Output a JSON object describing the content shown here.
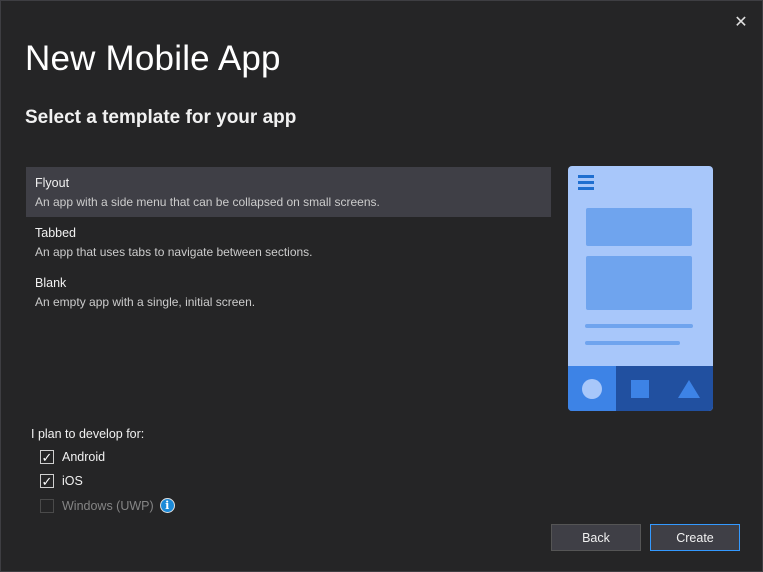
{
  "dialog": {
    "title": "New Mobile App",
    "subtitle": "Select a template for your app",
    "close_glyph": "✕"
  },
  "templates": [
    {
      "name": "Flyout",
      "description": "An app with a side menu that can be collapsed on small screens.",
      "selected": true
    },
    {
      "name": "Tabbed",
      "description": "An app that uses tabs to navigate between sections.",
      "selected": false
    },
    {
      "name": "Blank",
      "description": "An empty app with a single, initial screen.",
      "selected": false
    }
  ],
  "preview": {
    "icons": [
      "hamburger-menu-icon",
      "circle-tab-icon",
      "square-tab-icon",
      "triangle-tab-icon"
    ],
    "colors": {
      "background": "#a8c7fa",
      "accent": "#6fa4ee",
      "tabbar": "#2150a0",
      "active_tab": "#3d83e6"
    }
  },
  "platforms": {
    "label": "I plan to develop for:",
    "options": [
      {
        "label": "Android",
        "checked": true,
        "enabled": true
      },
      {
        "label": "iOS",
        "checked": true,
        "enabled": true
      },
      {
        "label": "Windows (UWP)",
        "checked": false,
        "enabled": false
      }
    ],
    "info_glyph": "i"
  },
  "buttons": {
    "back": "Back",
    "create": "Create"
  },
  "colors": {
    "focus_border": "#3399ff",
    "info": "#1b8ad8"
  }
}
